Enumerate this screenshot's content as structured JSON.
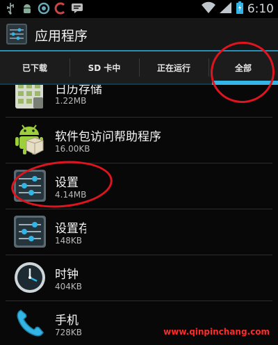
{
  "status_bar": {
    "time": "6:10",
    "icons": [
      "usb-icon",
      "android-icon",
      "sync-icon",
      "c-app-icon",
      "message-icon",
      "wifi-icon",
      "signal-icon",
      "battery-icon"
    ]
  },
  "action_bar": {
    "title": "应用程序",
    "icon": "settings-app-icon"
  },
  "tabs": [
    {
      "label": "已下载"
    },
    {
      "label": "SD 卡中"
    },
    {
      "label": "正在运行"
    },
    {
      "label": "全部",
      "selected": true
    }
  ],
  "apps": [
    {
      "name": "日历存储",
      "size": "1.22MB",
      "icon": "calendar-storage-icon"
    },
    {
      "name": "软件包访问帮助程序",
      "size": "16.00KB",
      "icon": "android-package-icon"
    },
    {
      "name": "设置",
      "size": "4.14MB",
      "icon": "settings-icon"
    },
    {
      "name": "设置存",
      "size": "148KB",
      "icon": "settings-storage-icon"
    },
    {
      "name": "时钟",
      "size": "404KB",
      "icon": "clock-icon"
    },
    {
      "name": "手机",
      "size": "728KB",
      "icon": "phone-icon"
    }
  ],
  "watermark": "www.qinpinchang.com",
  "colors": {
    "accent": "#33b5e5",
    "annotation": "#e0141e"
  }
}
